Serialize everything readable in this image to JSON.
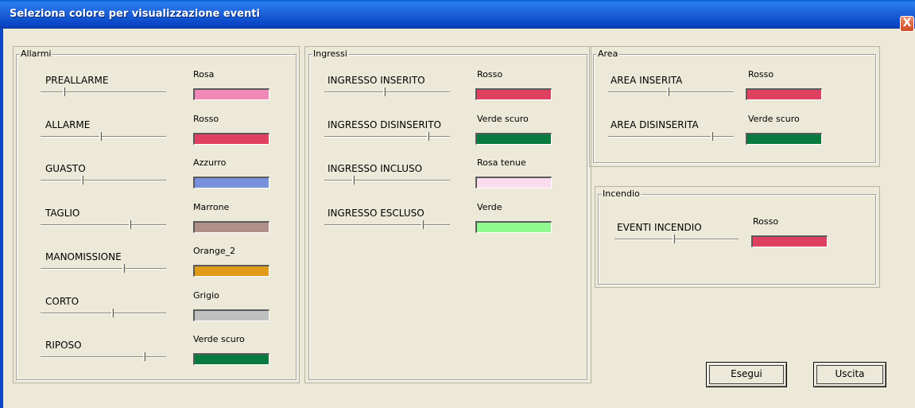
{
  "window": {
    "title": "Seleziona colore per visualizzazione eventi",
    "close_label": "X"
  },
  "groups": {
    "allarmi": {
      "label": "Allarmi",
      "rows": [
        {
          "label": "PREALLARME",
          "color_name": "Rosa",
          "color": "#f088b8",
          "slider_value": 0.18
        },
        {
          "label": "ALLARME",
          "color_name": "Rosso",
          "color": "#e04060",
          "slider_value": 0.48
        },
        {
          "label": "GUASTO",
          "color_name": "Azzurro",
          "color": "#7890dc",
          "slider_value": 0.33
        },
        {
          "label": "TAGLIO",
          "color_name": "Marrone",
          "color": "#b09088",
          "slider_value": 0.72
        },
        {
          "label": "MANOMISSIONE",
          "color_name": "Orange_2",
          "color": "#e09c18",
          "slider_value": 0.67
        },
        {
          "label": "CORTO",
          "color_name": "Grigio",
          "color": "#c0c0c0",
          "slider_value": 0.58
        },
        {
          "label": "RIPOSO",
          "color_name": "Verde scuro",
          "color": "#087a40",
          "slider_value": 0.84
        }
      ]
    },
    "ingressi": {
      "label": "Ingressi",
      "rows": [
        {
          "label": "INGRESSO INSERITO",
          "color_name": "Rosso",
          "color": "#e04060",
          "slider_value": 0.48
        },
        {
          "label": "INGRESSO DISINSERITO",
          "color_name": "Verde scuro",
          "color": "#087a40",
          "slider_value": 0.84
        },
        {
          "label": "INGRESSO INCLUSO",
          "color_name": "Rosa tenue",
          "color": "#fadcee",
          "slider_value": 0.23
        },
        {
          "label": "INGRESSO ESCLUSO",
          "color_name": "Verde",
          "color": "#90fa90",
          "slider_value": 0.79
        }
      ]
    },
    "area": {
      "label": "Area",
      "rows": [
        {
          "label": "AREA INSERITA",
          "color_name": "Rosso",
          "color": "#e04060",
          "slider_value": 0.48
        },
        {
          "label": "AREA DISINSERITA",
          "color_name": "Verde scuro",
          "color": "#087a40",
          "slider_value": 0.84
        }
      ]
    },
    "incendio": {
      "label": "Incendio",
      "rows": [
        {
          "label": "EVENTI INCENDIO",
          "color_name": "Rosso",
          "color": "#e04060",
          "slider_value": 0.48
        }
      ]
    }
  },
  "buttons": {
    "execute": "Esegui",
    "exit": "Uscita"
  }
}
